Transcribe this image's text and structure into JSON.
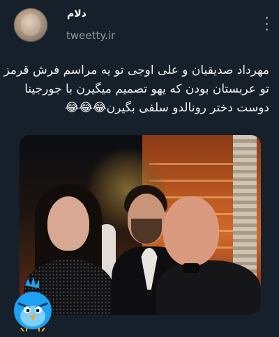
{
  "account": {
    "name": "دلام",
    "handle": "tweetty.ir"
  },
  "tweet": {
    "lines": [
      "مهرداد صدیقیان و علی اوجی تو یه مراسم فرش قرمز",
      "تو عربستان بودن که یهو تصمیم میگیرن با جورجینا",
      "دوست دختر رونالدو سلفی بگیرن😂😂😂"
    ]
  },
  "icons": {
    "more": "more-vertical-icon",
    "mascot": "blue-bird-mascot-icon"
  },
  "colors": {
    "background": "#15202b",
    "text": "#f1f3f4",
    "muted": "#8b98a5",
    "mascot": "#1da1f2"
  }
}
